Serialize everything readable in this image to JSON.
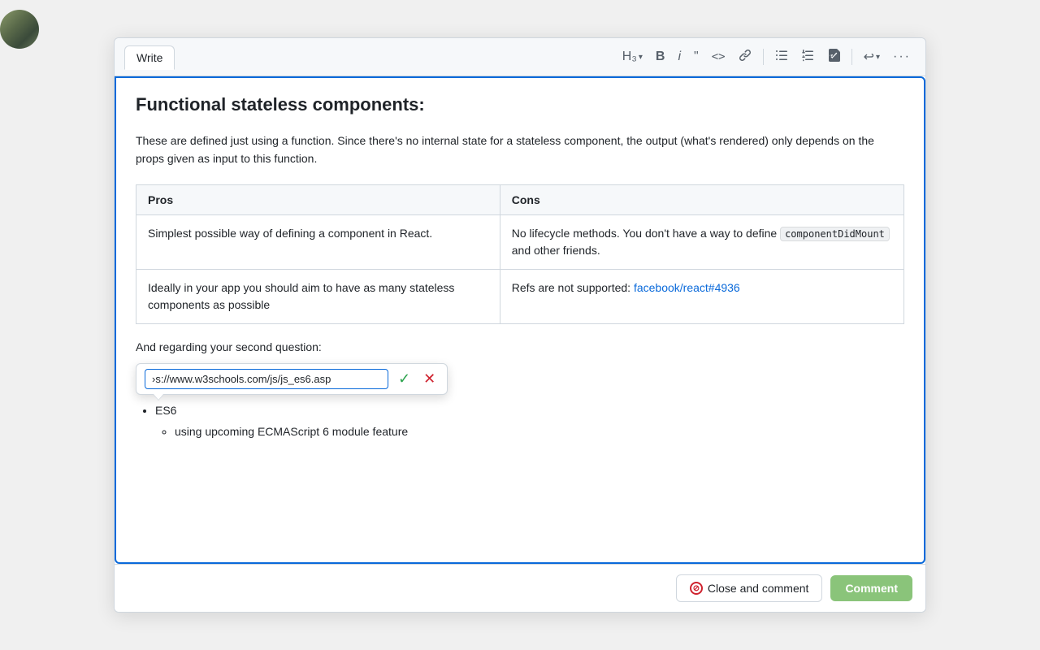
{
  "toolbar": {
    "write_tab": "Write",
    "h3_label": "H₃",
    "bold_label": "B",
    "italic_label": "i",
    "blockquote_label": "❝",
    "code_label": "<>",
    "link_label": "🔗",
    "bullet_list_label": "≡",
    "numbered_list_label": "≣",
    "task_list_label": "☑",
    "undo_label": "↩",
    "more_label": "···"
  },
  "editor": {
    "title": "Functional stateless components:",
    "paragraph": "These are defined just using a function. Since there's no internal state for a stateless component, the output (what's rendered) only depends on the props given as input to this function.",
    "table": {
      "headers": [
        "Pros",
        "Cons"
      ],
      "rows": [
        {
          "pro": "Simplest possible way of defining a component in React.",
          "con_text": "No lifecycle methods. You don't have a way to define ",
          "con_code": "componentDidMount",
          "con_suffix": " and other friends."
        },
        {
          "pro": "Ideally in your app you should aim to have as many stateless components as possible",
          "con_text": "Refs are not supported: ",
          "con_link": "facebook/react#4936",
          "con_link_href": "#"
        }
      ]
    },
    "second_question": "And regarding your second question:",
    "link_popup": {
      "url_value": "›s://www.w3schools.com/js/js_es6.asp"
    },
    "bullet_list": [
      {
        "text": "ES6",
        "sub_items": [
          "using upcoming ECMAScript 6 module feature"
        ]
      }
    ]
  },
  "footer": {
    "close_comment_label": "Close and comment",
    "comment_label": "Comment"
  }
}
